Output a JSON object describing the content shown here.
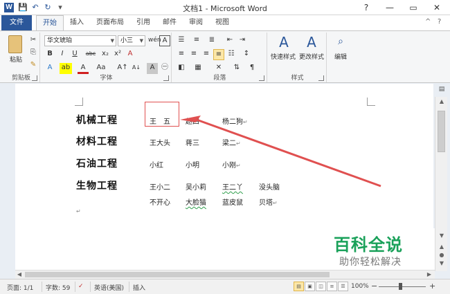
{
  "window": {
    "title": "文档1 - Microsoft Word",
    "help": "?",
    "minimize": "—",
    "restore": "▭",
    "close": "✕"
  },
  "qat": {
    "app_icon": "W",
    "save": "💾",
    "undo": "↶",
    "redo": "↻",
    "customize": "▾"
  },
  "tabs": {
    "file": "文件",
    "items": [
      "开始",
      "插入",
      "页面布局",
      "引用",
      "邮件",
      "审阅",
      "视图"
    ],
    "active": "开始",
    "right_help": "?",
    "right_collapse": "^"
  },
  "ribbon": {
    "clipboard": {
      "paste": "粘贴",
      "label": "剪贴板"
    },
    "font": {
      "font_name": "华文琥珀",
      "font_size": "小三",
      "phonetic": "wén",
      "border_char": "A",
      "bold": "B",
      "italic": "I",
      "underline": "U",
      "strike": "abc",
      "sub": "x₂",
      "sup": "x²",
      "clear": "A",
      "text_effect": "A",
      "highlight": "ab",
      "font_color": "A",
      "change_case": "Aa",
      "grow": "A↑",
      "shrink": "A↓",
      "char_shading": "A",
      "enclose": "㊀",
      "label": "字体"
    },
    "paragraph": {
      "label": "段落"
    },
    "styles": {
      "quick": "快速样式",
      "change": "更改样式",
      "label": "样式"
    },
    "editing": {
      "label": "编辑"
    }
  },
  "document": {
    "rows": [
      {
        "label": "机械工程",
        "names": [
          "王　五",
          "赵四",
          "杨二狗"
        ]
      },
      {
        "label": "材料工程",
        "names": [
          "王大头",
          "蒋三",
          "梁二"
        ]
      },
      {
        "label": "石油工程",
        "names": [
          "小红",
          "小明",
          "小刚"
        ]
      },
      {
        "label": "生物工程",
        "names": [
          "王小二",
          "吴小莉",
          "王二丫",
          "没头脑"
        ]
      },
      {
        "label": "",
        "names": [
          "不开心",
          "大脸猫",
          "蓝皮鼠",
          "贝塔"
        ]
      }
    ],
    "para_mark": "↵"
  },
  "watermark": {
    "title": "百科全说",
    "subtitle": "助你轻松解决"
  },
  "status": {
    "page": "页面: 1/1",
    "words": "字数: 59",
    "language": "英语(美国)",
    "mode": "插入",
    "zoom": "100%",
    "zoom_minus": "−",
    "zoom_plus": "+"
  },
  "colors": {
    "accent": "#2b579a",
    "annotation": "#e05050",
    "watermark_green": "#1aa15a"
  }
}
